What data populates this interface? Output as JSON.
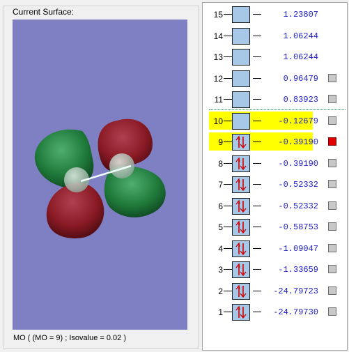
{
  "surface_panel": {
    "caption": "Current Surface:",
    "mo_label": "MO ( (MO = 9) ; Isovalue = 0.02 )"
  },
  "mo_list": [
    {
      "num": "15",
      "energy": "1.23807",
      "occupied": false,
      "selectable": false,
      "selected": false,
      "highlighted": false
    },
    {
      "num": "14",
      "energy": "1.06244",
      "occupied": false,
      "selectable": false,
      "selected": false,
      "highlighted": false
    },
    {
      "num": "13",
      "energy": "1.06244",
      "occupied": false,
      "selectable": false,
      "selected": false,
      "highlighted": false
    },
    {
      "num": "12",
      "energy": "0.96479",
      "occupied": false,
      "selectable": true,
      "selected": false,
      "highlighted": false
    },
    {
      "num": "11",
      "energy": "0.83923",
      "occupied": false,
      "selectable": true,
      "selected": false,
      "highlighted": false
    },
    {
      "num": "10",
      "energy": "-0.12679",
      "occupied": false,
      "selectable": true,
      "selected": false,
      "highlighted": true
    },
    {
      "num": "9",
      "energy": "-0.39190",
      "occupied": true,
      "selectable": true,
      "selected": true,
      "highlighted": true
    },
    {
      "num": "8",
      "energy": "-0.39190",
      "occupied": true,
      "selectable": true,
      "selected": false,
      "highlighted": false
    },
    {
      "num": "7",
      "energy": "-0.52332",
      "occupied": true,
      "selectable": true,
      "selected": false,
      "highlighted": false
    },
    {
      "num": "6",
      "energy": "-0.52332",
      "occupied": true,
      "selectable": true,
      "selected": false,
      "highlighted": false
    },
    {
      "num": "5",
      "energy": "-0.58753",
      "occupied": true,
      "selectable": true,
      "selected": false,
      "highlighted": false
    },
    {
      "num": "4",
      "energy": "-1.09047",
      "occupied": true,
      "selectable": true,
      "selected": false,
      "highlighted": false
    },
    {
      "num": "3",
      "energy": "-1.33659",
      "occupied": true,
      "selectable": true,
      "selected": false,
      "highlighted": false
    },
    {
      "num": "2",
      "energy": "-24.79723",
      "occupied": true,
      "selectable": true,
      "selected": false,
      "highlighted": false
    },
    {
      "num": "1",
      "energy": "-24.79730",
      "occupied": true,
      "selectable": true,
      "selected": false,
      "highlighted": false
    }
  ],
  "colors": {
    "viewport_background": "#7f7fc4",
    "highlight": "#ffff00",
    "energy_text": "#2020c8",
    "selected_indicator": "#e00000",
    "lobe_positive": "#8a1a24",
    "lobe_negative": "#1f7a3a"
  }
}
